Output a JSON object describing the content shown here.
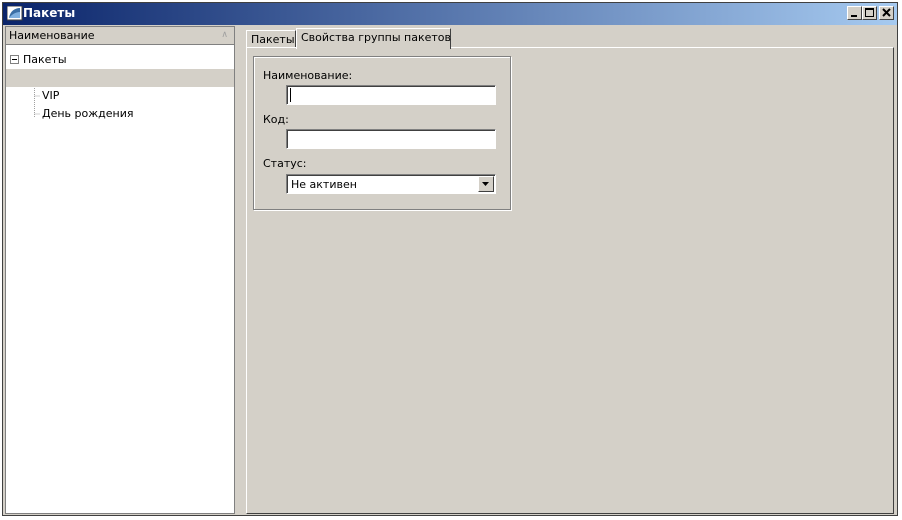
{
  "window": {
    "title": "Пакеты"
  },
  "left_panel": {
    "column_header": "Наименование",
    "tree": {
      "root": "Пакеты",
      "children": [
        {
          "label": "",
          "selected": true
        },
        {
          "label": "VIP"
        },
        {
          "label": "День рождения"
        }
      ]
    }
  },
  "tabs": [
    {
      "label": "Пакеты",
      "active": false
    },
    {
      "label": "Свойства группы пакетов",
      "active": true
    }
  ],
  "form": {
    "name": {
      "label": "Наименование:",
      "value": ""
    },
    "code": {
      "label": "Код:",
      "value": ""
    },
    "status": {
      "label": "Статус:",
      "value": "Не активен"
    }
  },
  "icons": {
    "window": "window-app-icon",
    "minimize": "minimize-icon",
    "maximize": "maximize-icon",
    "close": "close-icon",
    "dropdown": "chevron-down-icon",
    "sort": "sort-arrow-icon"
  },
  "colors": {
    "titlebar_start": "#0a246a",
    "titlebar_end": "#a6caf0",
    "face": "#d4d0c8"
  }
}
